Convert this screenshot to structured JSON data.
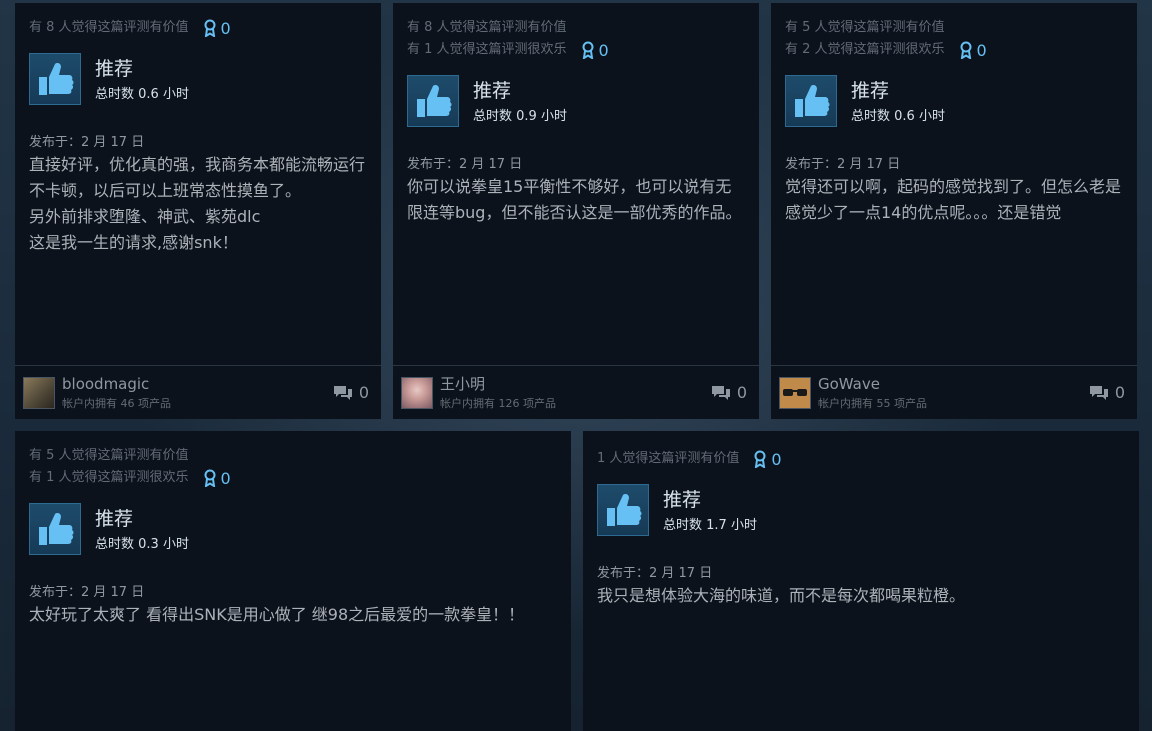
{
  "colors": {
    "card_bg": "#0c121b",
    "accent": "#66c0f4",
    "text": "#acb2b8"
  },
  "reviews": [
    {
      "helpful": [
        "有 8 人觉得这篇评测有价值"
      ],
      "awards": "0",
      "recommendation": "推荐",
      "hours": "总时数 0.6 小时",
      "posted": "发布于：2 月 17 日",
      "text": "直接好评，优化真的强，我商务本都能流畅运行不卡顿，以后可以上班常态性摸鱼了。\n另外前排求堕隆、神武、紫苑dlc\n这是我一生的请求,感谢snk！",
      "author": "bloodmagic",
      "products": "帐户内拥有 46 项产品",
      "comments": "0",
      "avatar_icon": "avatar-photo-icon"
    },
    {
      "helpful": [
        "有 8 人觉得这篇评测有价值",
        "有 1 人觉得这篇评测很欢乐"
      ],
      "awards": "0",
      "recommendation": "推荐",
      "hours": "总时数 0.9 小时",
      "posted": "发布于：2 月 17 日",
      "text": "你可以说拳皇15平衡性不够好，也可以说有无限连等bug，但不能否认这是一部优秀的作品。",
      "author": "王小明",
      "products": "帐户内拥有 126 项产品",
      "comments": "0",
      "avatar_icon": "avatar-anime-icon"
    },
    {
      "helpful": [
        "有 5 人觉得这篇评测有价值",
        "有 2 人觉得这篇评测很欢乐"
      ],
      "awards": "0",
      "recommendation": "推荐",
      "hours": "总时数 0.6 小时",
      "posted": "发布于：2 月 17 日",
      "text": "觉得还可以啊，起码的感觉找到了。但怎么老是感觉少了一点14的优点呢。。。还是错觉",
      "author": "GoWave",
      "products": "帐户内拥有 55 项产品",
      "comments": "0",
      "avatar_icon": "avatar-sunglasses-icon"
    },
    {
      "helpful": [
        "有 5 人觉得这篇评测有价值",
        "有 1 人觉得这篇评测很欢乐"
      ],
      "awards": "0",
      "recommendation": "推荐",
      "hours": "总时数 0.3 小时",
      "posted": "发布于：2 月 17 日",
      "text": "太好玩了太爽了 看得出SNK是用心做了 继98之后最爱的一款拳皇！！"
    },
    {
      "helpful": [
        "1 人觉得这篇评测有价值"
      ],
      "awards": "0",
      "recommendation": "推荐",
      "hours": "总时数 1.7 小时",
      "posted": "发布于：2 月 17 日",
      "text": "我只是想体验大海的味道，而不是每次都喝果粒橙。"
    }
  ]
}
